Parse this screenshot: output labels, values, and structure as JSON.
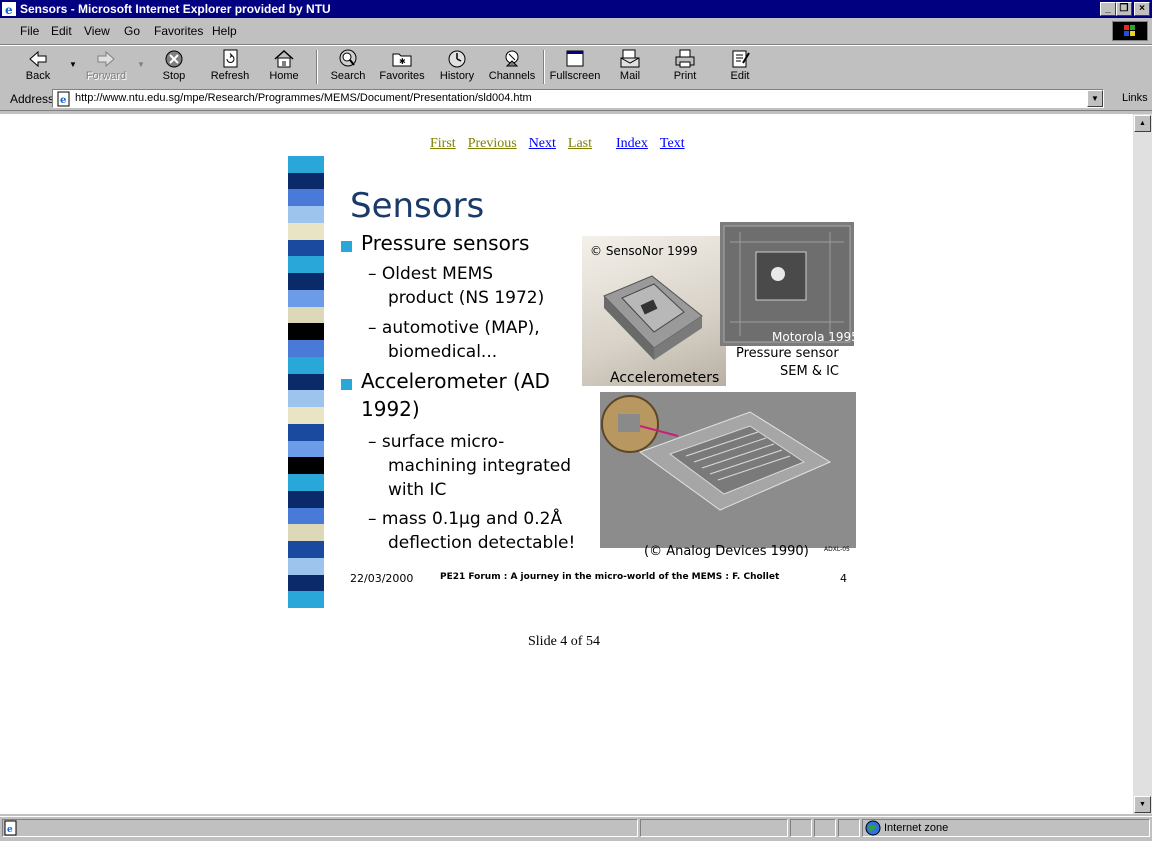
{
  "window": {
    "title": "Sensors - Microsoft Internet Explorer provided by NTU",
    "min_glyph": "_",
    "max_glyph": "❐",
    "close_glyph": "×"
  },
  "menu": [
    {
      "label": "File"
    },
    {
      "label": "Edit"
    },
    {
      "label": "View"
    },
    {
      "label": "Go"
    },
    {
      "label": "Favorites"
    },
    {
      "label": "Help"
    }
  ],
  "toolbar": {
    "back": "Back",
    "forward": "Forward",
    "stop": "Stop",
    "refresh": "Refresh",
    "home": "Home",
    "search": "Search",
    "favorites": "Favorites",
    "history": "History",
    "channels": "Channels",
    "fullscreen": "Fullscreen",
    "mail": "Mail",
    "print": "Print",
    "edit": "Edit"
  },
  "address": {
    "label": "Address",
    "url": "http://www.ntu.edu.sg/mpe/Research/Programmes/MEMS/Document/Presentation/sld004.htm",
    "links": "Links"
  },
  "nav": {
    "first": "First",
    "previous": "Previous",
    "next": "Next",
    "last": "Last",
    "index": "Index",
    "text": "Text"
  },
  "slide": {
    "title": "Sensors",
    "bullet1": "Pressure sensors",
    "sub1a_l1": "– Oldest MEMS",
    "sub1a_l2": "product (NS 1972)",
    "sub1b_l1": "– automotive (MAP),",
    "sub1b_l2": "biomedical...",
    "bullet2_l1": "Accelerometer (AD",
    "bullet2_l2": "1992)",
    "sub2a_l1": "– surface micro-",
    "sub2a_l2": "machining integrated",
    "sub2a_l3": "with IC",
    "sub2b_l1": "– mass 0.1µg and 0.2Å",
    "sub2b_l2": "deflection detectable!",
    "cap_sensonor": "© SensoNor 1999",
    "cap_accel": "Accelerometers",
    "cap_motorola": "Motorola 1995",
    "cap_pressure_l1": "Pressure sensor",
    "cap_pressure_l2": "SEM & IC",
    "cap_analog": "(© Analog Devices 1990)",
    "cap_adxl": "ADXL-05",
    "footer_date": "22/03/2000",
    "footer_text": "PE21 Forum : A journey in the micro-world of the MEMS : F. Chollet",
    "footer_num": "4"
  },
  "slide_count": "Slide 4 of 54",
  "status": {
    "zone": "Internet zone"
  },
  "colors": {
    "titlebar": "#000080",
    "chrome": "#c0c0c0",
    "slide_title": "#1a3a6a",
    "bullet": "#29a7d8",
    "link_visited": "#808000",
    "link": "#0000ff"
  }
}
